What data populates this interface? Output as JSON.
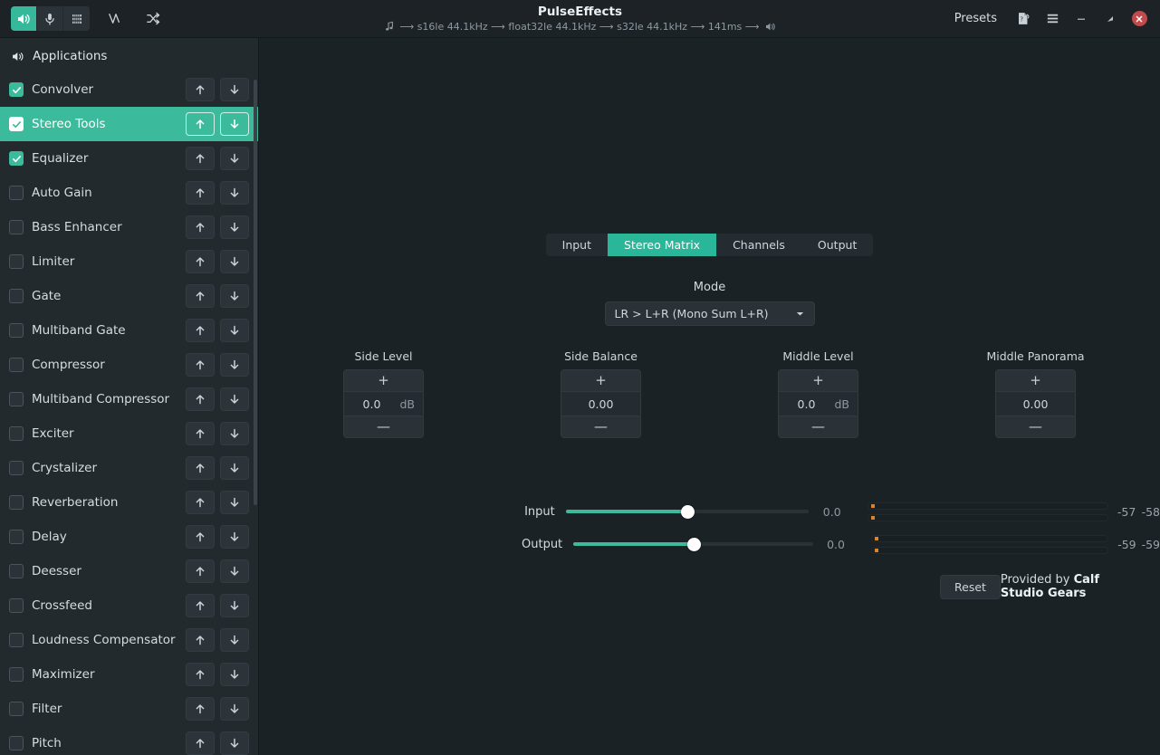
{
  "header": {
    "title": "PulseEffects",
    "pipeline": [
      "s16le 44.1kHz",
      "float32le 44.1kHz",
      "s32le 44.1kHz",
      "141ms"
    ],
    "pipeline_text": "⟶ s16le 44.1kHz ⟶ float32le 44.1kHz ⟶ s32le 44.1kHz ⟶ 141ms ⟶",
    "mode_buttons": [
      {
        "name": "speaker-icon",
        "label": "Output Devices",
        "active": true
      },
      {
        "name": "microphone-icon",
        "label": "Input Devices",
        "active": false
      },
      {
        "name": "equalizer-grid-icon",
        "label": "PipeWire",
        "active": false
      }
    ],
    "tool_buttons": [
      {
        "name": "waveform-icon",
        "label": "Spectrum"
      },
      {
        "name": "shuffle-routing-icon",
        "label": "Routing"
      }
    ],
    "presets_label": "Presets",
    "help_icon": "help-document-icon",
    "menu_icon": "hamburger-menu-icon",
    "window_controls": [
      "minimize",
      "maximize",
      "close"
    ],
    "accent_color": "#3cbb9c",
    "close_color": "#c24a4a"
  },
  "sidebar": {
    "apps_label": "Applications",
    "apps_icon": "speaker-icon",
    "move_up_icon": "arrow-up-icon",
    "move_down_icon": "arrow-down-icon",
    "plugins": [
      {
        "label": "Convolver",
        "enabled": true,
        "selected": false
      },
      {
        "label": "Stereo Tools",
        "enabled": true,
        "selected": true
      },
      {
        "label": "Equalizer",
        "enabled": true,
        "selected": false
      },
      {
        "label": "Auto Gain",
        "enabled": false,
        "selected": false
      },
      {
        "label": "Bass Enhancer",
        "enabled": false,
        "selected": false
      },
      {
        "label": "Limiter",
        "enabled": false,
        "selected": false
      },
      {
        "label": "Gate",
        "enabled": false,
        "selected": false
      },
      {
        "label": "Multiband Gate",
        "enabled": false,
        "selected": false
      },
      {
        "label": "Compressor",
        "enabled": false,
        "selected": false
      },
      {
        "label": "Multiband Compressor",
        "enabled": false,
        "selected": false
      },
      {
        "label": "Exciter",
        "enabled": false,
        "selected": false
      },
      {
        "label": "Crystalizer",
        "enabled": false,
        "selected": false
      },
      {
        "label": "Reverberation",
        "enabled": false,
        "selected": false
      },
      {
        "label": "Delay",
        "enabled": false,
        "selected": false
      },
      {
        "label": "Deesser",
        "enabled": false,
        "selected": false
      },
      {
        "label": "Crossfeed",
        "enabled": false,
        "selected": false
      },
      {
        "label": "Loudness Compensator",
        "enabled": false,
        "selected": false
      },
      {
        "label": "Maximizer",
        "enabled": false,
        "selected": false
      },
      {
        "label": "Filter",
        "enabled": false,
        "selected": false
      },
      {
        "label": "Pitch",
        "enabled": false,
        "selected": false
      }
    ]
  },
  "main": {
    "tabs": [
      {
        "label": "Input",
        "active": false
      },
      {
        "label": "Stereo Matrix",
        "active": true
      },
      {
        "label": "Channels",
        "active": false
      },
      {
        "label": "Output",
        "active": false
      }
    ],
    "mode": {
      "label": "Mode",
      "value": "LR > L+R (Mono Sum L+R)",
      "dropdown_icon": "chevron-down-icon"
    },
    "spinners": [
      {
        "title": "Side Level",
        "value": "0.0",
        "unit": "dB",
        "plus": "+",
        "minus": "—"
      },
      {
        "title": "Side Balance",
        "value": "0.00",
        "unit": "",
        "plus": "+",
        "minus": "—"
      },
      {
        "title": "Middle Level",
        "value": "0.0",
        "unit": "dB",
        "plus": "+",
        "minus": "—"
      },
      {
        "title": "Middle Panorama",
        "value": "0.00",
        "unit": "",
        "plus": "+",
        "minus": "—"
      }
    ],
    "levels": [
      {
        "label": "Input",
        "gain": "0.0",
        "slider_percent": 50,
        "meter_left": "-57",
        "meter_right": "-58"
      },
      {
        "label": "Output",
        "gain": "0.0",
        "slider_percent": 50,
        "meter_left": "-59",
        "meter_right": "-59"
      }
    ],
    "reset_label": "Reset",
    "provided_prefix": "Provided by ",
    "provided_vendor": "Calf Studio Gears"
  }
}
